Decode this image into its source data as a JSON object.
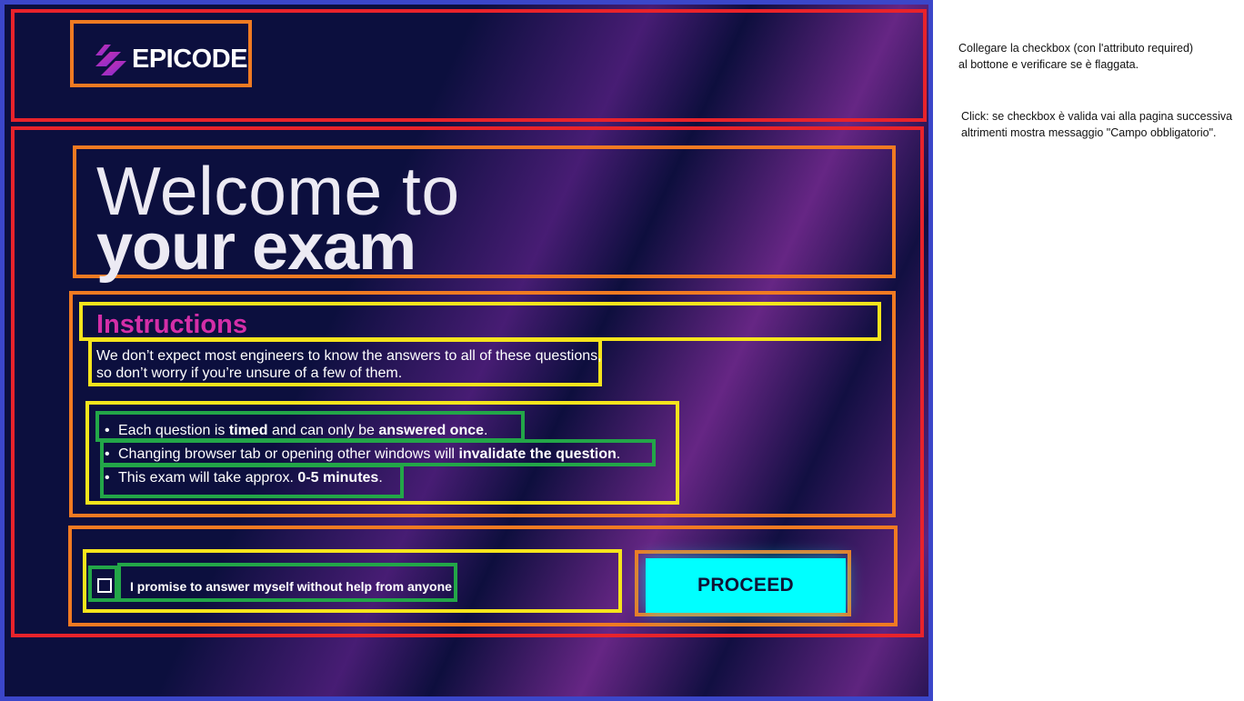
{
  "logo": {
    "text": "EPICODE",
    "colors": [
      "#7b2dd6",
      "#d42ea8"
    ]
  },
  "title": {
    "line1": "Welcome to",
    "line2": "your exam"
  },
  "instructions": {
    "heading": "Instructions",
    "intro": "We don’t expect most engineers to know the answers to all of these questions, so don’t worry if you’re unsure of a few of them.",
    "bullets": [
      {
        "bullet": "•",
        "before": "Each question is ",
        "bold1": "timed",
        "mid": " and can only be ",
        "bold2": "answered once",
        "after": "."
      },
      {
        "bullet": "•",
        "before": "Changing browser tab or opening other windows will ",
        "bold1": "invalidate the question",
        "after": "."
      },
      {
        "bullet": "•",
        "before": "This exam will take approx. ",
        "bold1": "0-5 minutes",
        "after": "."
      }
    ]
  },
  "promise": {
    "label": "I promise to answer myself without help from anyone",
    "checked": false
  },
  "proceed_button": {
    "label": "PROCEED"
  },
  "notes": {
    "note1": {
      "line1": "Collegare la checkbox (con l'attributo required)",
      "line2": "al bottone e verificare se è flaggata."
    },
    "note2": {
      "line1": "Click: se checkbox è valida  vai alla pagina successiva",
      "line2": "altrimenti mostra messaggio \"Campo obbligatorio\"."
    }
  },
  "colors": {
    "background": "#0c0f3e",
    "accent_cyan": "#00ffff",
    "heading_magenta": "#d42ea8",
    "outer_border": "#3b46c9",
    "annotation_red": "#e8232b",
    "annotation_orange": "#f07a22",
    "annotation_yellow": "#f5e41c",
    "annotation_green": "#23a648"
  }
}
